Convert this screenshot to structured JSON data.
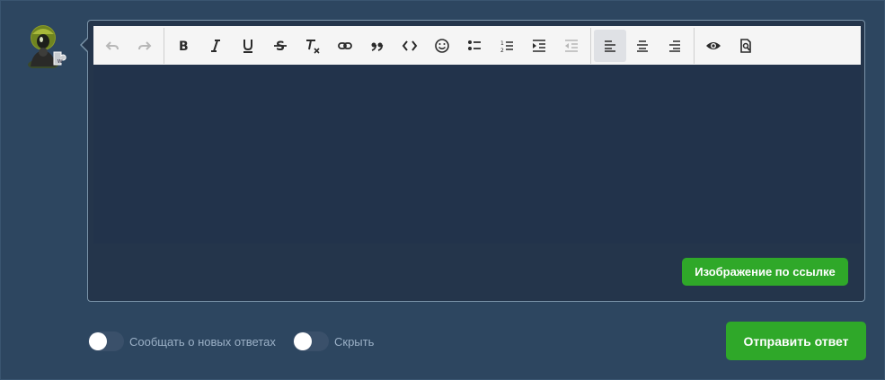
{
  "toolbar": {
    "buttons": [
      {
        "name": "undo",
        "icon": "undo-icon",
        "disabled": true
      },
      {
        "name": "redo",
        "icon": "redo-icon",
        "disabled": true
      },
      {
        "name": "bold",
        "icon": "bold-icon",
        "glyph": "B"
      },
      {
        "name": "italic",
        "icon": "italic-icon",
        "glyph": "I"
      },
      {
        "name": "underline",
        "icon": "underline-icon",
        "glyph": "U"
      },
      {
        "name": "strikethrough",
        "icon": "strikethrough-icon",
        "glyph": "S"
      },
      {
        "name": "clear-formatting",
        "icon": "clear-formatting-icon",
        "glyph": "T"
      },
      {
        "name": "link",
        "icon": "link-icon"
      },
      {
        "name": "blockquote",
        "icon": "quote-icon"
      },
      {
        "name": "code",
        "icon": "code-icon"
      },
      {
        "name": "emoji",
        "icon": "emoji-icon"
      },
      {
        "name": "bullet-list",
        "icon": "bullet-list-icon"
      },
      {
        "name": "numbered-list",
        "icon": "numbered-list-icon"
      },
      {
        "name": "indent",
        "icon": "indent-icon"
      },
      {
        "name": "outdent",
        "icon": "outdent-icon",
        "disabled": true
      },
      {
        "name": "align-left",
        "icon": "align-left-icon",
        "active": true
      },
      {
        "name": "align-center",
        "icon": "align-center-icon"
      },
      {
        "name": "align-right",
        "icon": "align-right-icon"
      },
      {
        "name": "toggle-preview",
        "icon": "eye-icon"
      },
      {
        "name": "preview",
        "icon": "preview-document-icon"
      }
    ]
  },
  "editor": {
    "value": ""
  },
  "image_by_link_label": "Изображение по ссылке",
  "options": {
    "notify_label": "Сообщать о новых ответах",
    "notify_on": false,
    "hide_label": "Скрыть",
    "hide_on": false
  },
  "submit_label": "Отправить ответ",
  "colors": {
    "background": "#2d4660",
    "editor": "#22334b",
    "accent_green": "#2fa829",
    "toolbar": "#f5f5f5"
  }
}
